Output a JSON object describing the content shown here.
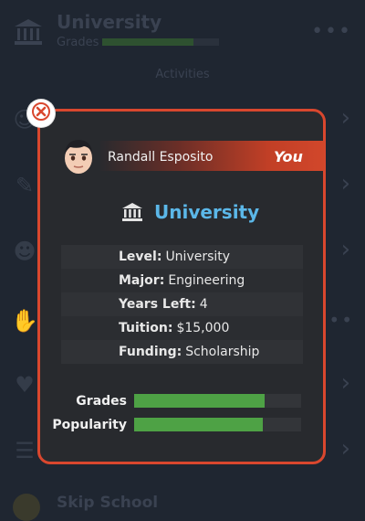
{
  "background": {
    "header": {
      "title": "University",
      "subtitle": "Grades",
      "grade_progress": 0.78,
      "icon": "university-icon"
    },
    "section_label": "Activities",
    "items": [
      {
        "label": "Activities",
        "icon": "group-icon"
      },
      {
        "label": "",
        "icon": "pencil-icon"
      },
      {
        "label": "",
        "icon": "faces-icon"
      },
      {
        "label": "",
        "icon": "hand-icon"
      },
      {
        "label": "",
        "icon": "heart-icon"
      },
      {
        "label": "",
        "icon": "list-icon"
      }
    ],
    "skip_label": "Skip School"
  },
  "modal": {
    "user": {
      "name": "Randall Esposito",
      "tag": "You",
      "avatar": "avatar-icon"
    },
    "title": "University",
    "title_icon": "university-icon",
    "info": [
      {
        "key": "Level:",
        "value": "University"
      },
      {
        "key": "Major:",
        "value": "Engineering"
      },
      {
        "key": "Years Left:",
        "value": "4"
      },
      {
        "key": "Tuition:",
        "value": "$15,000"
      },
      {
        "key": "Funding:",
        "value": "Scholarship"
      }
    ],
    "stats": [
      {
        "label": "Grades",
        "value": 0.78
      },
      {
        "label": "Popularity",
        "value": 0.77
      }
    ],
    "colors": {
      "accent": "#d9472e",
      "title": "#5bb7e8",
      "stat_fill": "#4ea245"
    }
  }
}
